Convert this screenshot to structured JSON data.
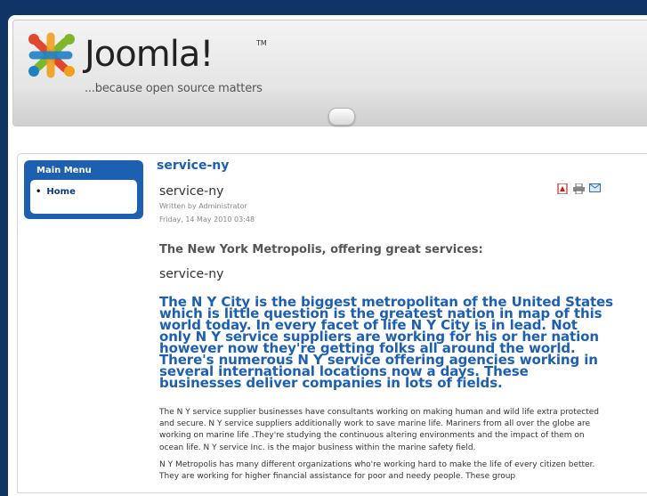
{
  "header": {
    "logo_text": "Joomla!",
    "tm": "TM",
    "tagline": "...because open source matters"
  },
  "sidebar": {
    "menu_title": "Main Menu",
    "items": [
      {
        "label": "Home"
      }
    ]
  },
  "article": {
    "section_heading": "service-ny",
    "title": "service-ny",
    "author": "Written by Administrator",
    "date": "Friday, 14 May 2010 03:48",
    "intro": "The New York Metropolis, offering great services:",
    "subtitle": "service-ny",
    "lead": "The N Y City is the biggest metropolitan of the United States which is little question is the greatest nation in map of this world today. In every facet of life N Y City is in lead. Not only N Y service suppliers are working for his or her nation however now they're getting folks all around the world. There's numerous N Y service offering agencies working in several international locations now a days. These businesses deliver companies in lots of fields.",
    "paragraphs": [
      "The N Y service supplier businesses have consultants working on making human and wild life extra protected and secure. N Y service suppliers additionally work to save marine life. Mariners from all over the globe are working on marine life .They're studying the continuous altering environments and the impact of them on ocean life. N Y service Inc. is the major business within the marine safety field.",
      "N Y Metropolis has many different organizations who're working hard to make the life of every citizen better. They are working for higher financial assistance for poor and needy people. These group"
    ]
  },
  "icons": [
    "pdf-icon",
    "print-icon",
    "email-icon"
  ]
}
